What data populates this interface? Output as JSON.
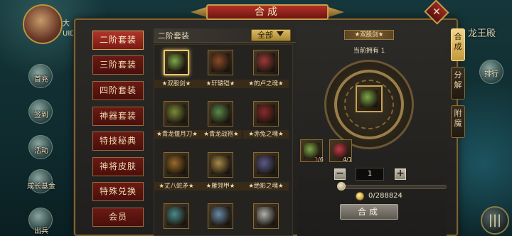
{
  "background": {
    "avatar_tag": "大",
    "avatar_uid": "UID",
    "left_menu": [
      "首充",
      "签到",
      "活动",
      "成长基金",
      "出兵"
    ],
    "right_title": "龙王殿",
    "right_menu_label": "排行"
  },
  "window": {
    "title": "合成",
    "close_label": "✕"
  },
  "categories": [
    {
      "label": "二阶套装",
      "active": true
    },
    {
      "label": "三阶套装",
      "active": false
    },
    {
      "label": "四阶套装",
      "active": false
    },
    {
      "label": "神器套装",
      "active": false
    },
    {
      "label": "特技秘典",
      "active": false
    },
    {
      "label": "神将皮肤",
      "active": false
    },
    {
      "label": "特殊兑换",
      "active": false
    },
    {
      "label": "会员",
      "active": false
    }
  ],
  "grid": {
    "heading": "二阶套装",
    "filter_label": "全部",
    "items": [
      {
        "label": "★双股剑★",
        "icon": "twin-swords-icon",
        "color": "#7fa84a",
        "selected": true
      },
      {
        "label": "★轩辕铠★",
        "icon": "armor-icon",
        "color": "#8a4a2a",
        "selected": false
      },
      {
        "label": "★的卢之魂★",
        "icon": "horse-soul-icon",
        "color": "#9a3a3a",
        "selected": false
      },
      {
        "label": "★青龙偃月刀★",
        "icon": "glaive-icon",
        "color": "#7a8a3a",
        "selected": false
      },
      {
        "label": "★青龙战袍★",
        "icon": "battle-robe-icon",
        "color": "#5a8a4a",
        "selected": false
      },
      {
        "label": "★赤兔之魂★",
        "icon": "red-horse-soul-icon",
        "color": "#8a2a2a",
        "selected": false
      },
      {
        "label": "★丈八蛇矛★",
        "icon": "serpent-spear-icon",
        "color": "#9a6a2a",
        "selected": false
      },
      {
        "label": "★雁翎甲★",
        "icon": "feather-armor-icon",
        "color": "#a88a4a",
        "selected": false
      },
      {
        "label": "★绝影之魂★",
        "icon": "shadow-horse-soul-icon",
        "color": "#5a5a8a",
        "selected": false
      },
      {
        "label": "",
        "icon": "spear-icon",
        "color": "#4a8a8a",
        "selected": false
      },
      {
        "label": "",
        "icon": "robe-icon",
        "color": "#6a8aa8",
        "selected": false
      },
      {
        "label": "",
        "icon": "white-horse-icon",
        "color": "#b0b0b0",
        "selected": false
      }
    ]
  },
  "detail": {
    "selected_name": "★双股剑★",
    "owned_text": "当前拥有 1",
    "materials": [
      {
        "icon": "sword-fragment-icon",
        "color": "#7fa84a",
        "have": "3",
        "need": "/6"
      },
      {
        "icon": "red-gem-icon",
        "color": "#c23a4a",
        "have": "4",
        "need": "/1"
      }
    ],
    "quantity": "1",
    "minus_label": "−",
    "plus_label": "+",
    "slider_fraction": 0,
    "cost_text": "0/288824",
    "craft_label": "合成"
  },
  "side_tabs": [
    {
      "label": "合成",
      "active": true
    },
    {
      "label": "分解",
      "active": false
    },
    {
      "label": "附魔",
      "active": false
    }
  ]
}
